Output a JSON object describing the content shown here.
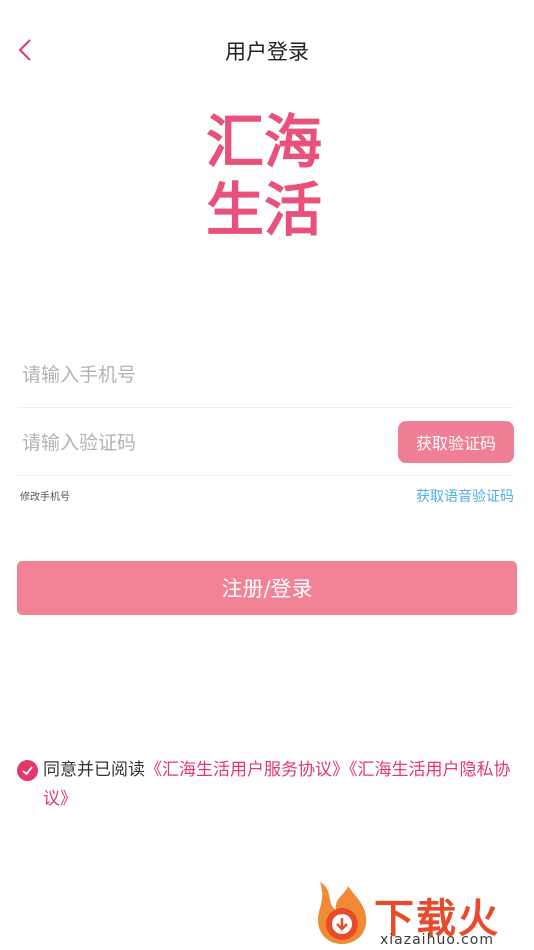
{
  "header": {
    "title": "用户登录"
  },
  "logo": {
    "line1": "汇海",
    "line2": "生活"
  },
  "form": {
    "phone_placeholder": "请输入手机号",
    "code_placeholder": "请输入验证码",
    "get_code_label": "获取验证码",
    "change_phone_label": "修改手机号",
    "voice_code_label": "获取语音验证码",
    "submit_label": "注册/登录"
  },
  "agreement": {
    "checked": true,
    "prefix": "同意并已阅读",
    "service_link": "《汇海生活用户服务协议》",
    "privacy_link": "《汇海生活用户隐私协议》"
  },
  "watermark": {
    "text": "下载火",
    "url": "xiazaihuo.com"
  },
  "colors": {
    "accent": "#e4386a",
    "button": "#f28296",
    "link_blue": "#4eaee8"
  }
}
